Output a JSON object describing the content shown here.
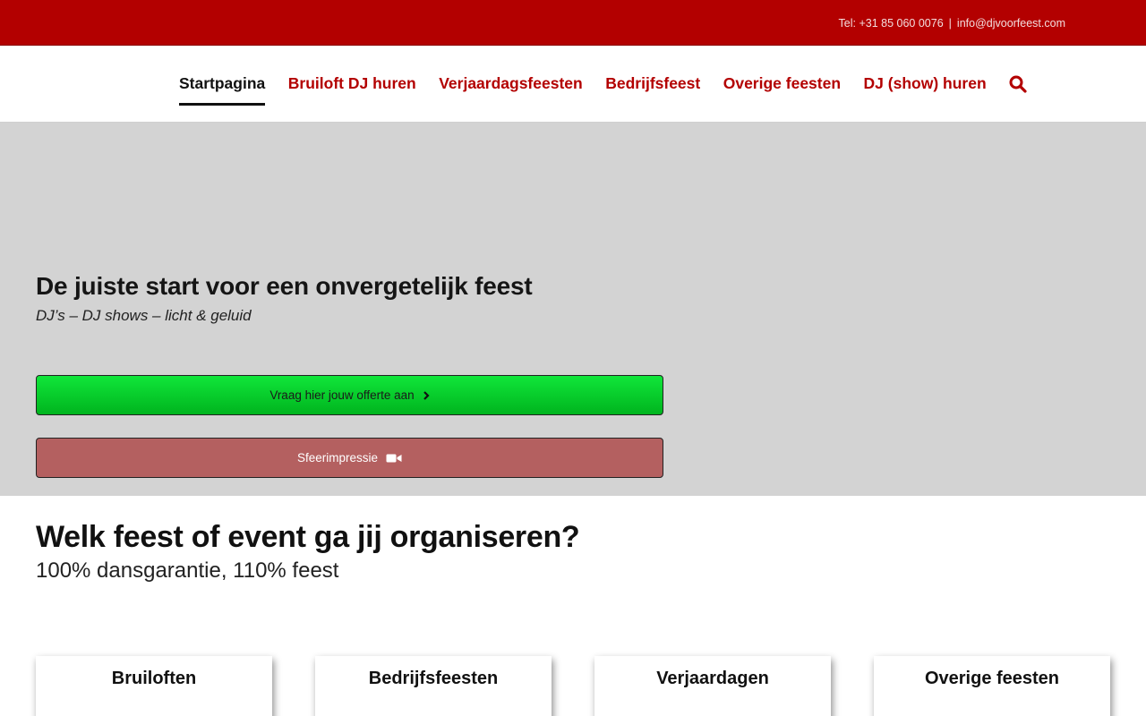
{
  "topbar": {
    "phone": "Tel: +31 85 060 0076",
    "separator": "|",
    "email": "info@djvoorfeest.com"
  },
  "nav": {
    "items": [
      {
        "label": "Startpagina",
        "active": true
      },
      {
        "label": "Bruiloft DJ huren",
        "active": false
      },
      {
        "label": "Verjaardagsfeesten",
        "active": false
      },
      {
        "label": "Bedrijfsfeest",
        "active": false
      },
      {
        "label": "Overige feesten",
        "active": false
      },
      {
        "label": "DJ (show) huren",
        "active": false
      }
    ],
    "search_icon": "search-icon"
  },
  "hero": {
    "title": "De juiste start voor een onvergetelijk feest",
    "subtitle": "DJ’s – DJ shows – licht & geluid",
    "offer_button": "Vraag hier jouw offerte aan",
    "impressie_button": "Sfeerimpressie"
  },
  "section": {
    "title": "Welk feest of event ga jij organiseren?",
    "subtitle": "100% dansgarantie, 110% feest"
  },
  "cards": [
    {
      "title": "Bruiloften"
    },
    {
      "title": "Bedrijfsfeesten"
    },
    {
      "title": "Verjaardagen"
    },
    {
      "title": "Overige feesten"
    }
  ],
  "colors": {
    "brand_red": "#b30000",
    "offer_green": "#00d42a",
    "impressie_red": "#b46060"
  }
}
